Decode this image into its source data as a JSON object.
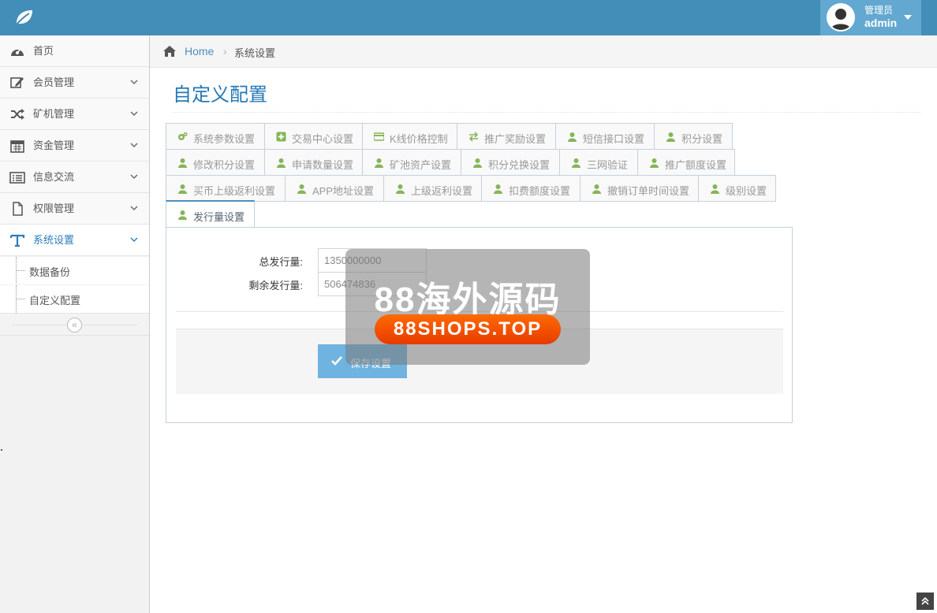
{
  "navbar": {
    "user_role": "管理员",
    "user_name": "admin"
  },
  "sidebar": {
    "items": [
      {
        "label": "首页"
      },
      {
        "label": "会员管理"
      },
      {
        "label": "矿机管理"
      },
      {
        "label": "资金管理"
      },
      {
        "label": "信息交流"
      },
      {
        "label": "权限管理"
      },
      {
        "label": "系统设置"
      }
    ],
    "sub_items": [
      {
        "label": "数据备份"
      },
      {
        "label": "自定义配置"
      }
    ],
    "collapse_glyph": "«"
  },
  "breadcrumb": {
    "home": "Home",
    "separator": "›",
    "current": "系统设置"
  },
  "page": {
    "title": "自定义配置"
  },
  "tabs": {
    "row1": [
      "系统参数设置",
      "交易中心设置",
      "K线价格控制",
      "推广奖励设置",
      "短信接口设置",
      "积分设置"
    ],
    "row2": [
      "修改积分设置",
      "申请数量设置",
      "矿池资产设置",
      "积分兑换设置",
      "三网验证",
      "推广额度设置"
    ],
    "row3": [
      "买币上级返利设置",
      "APP地址设置",
      "上级返利设置",
      "扣费额度设置",
      "撤销订单时间设置",
      "级别设置"
    ],
    "row4": [
      "发行量设置"
    ]
  },
  "form": {
    "total_label": "总发行量:",
    "total_value": "1350000000",
    "remaining_label": "剩余发行量:",
    "remaining_value": "506474836",
    "save_label": "保存设置"
  },
  "watermark": {
    "title": "88海外源码",
    "url": "88SHOPS.TOP"
  },
  "colors": {
    "navbar": "#438eb9",
    "accent": "#2679b5",
    "tab_icon": "#86b558",
    "save_button": "#6fb3e0"
  }
}
